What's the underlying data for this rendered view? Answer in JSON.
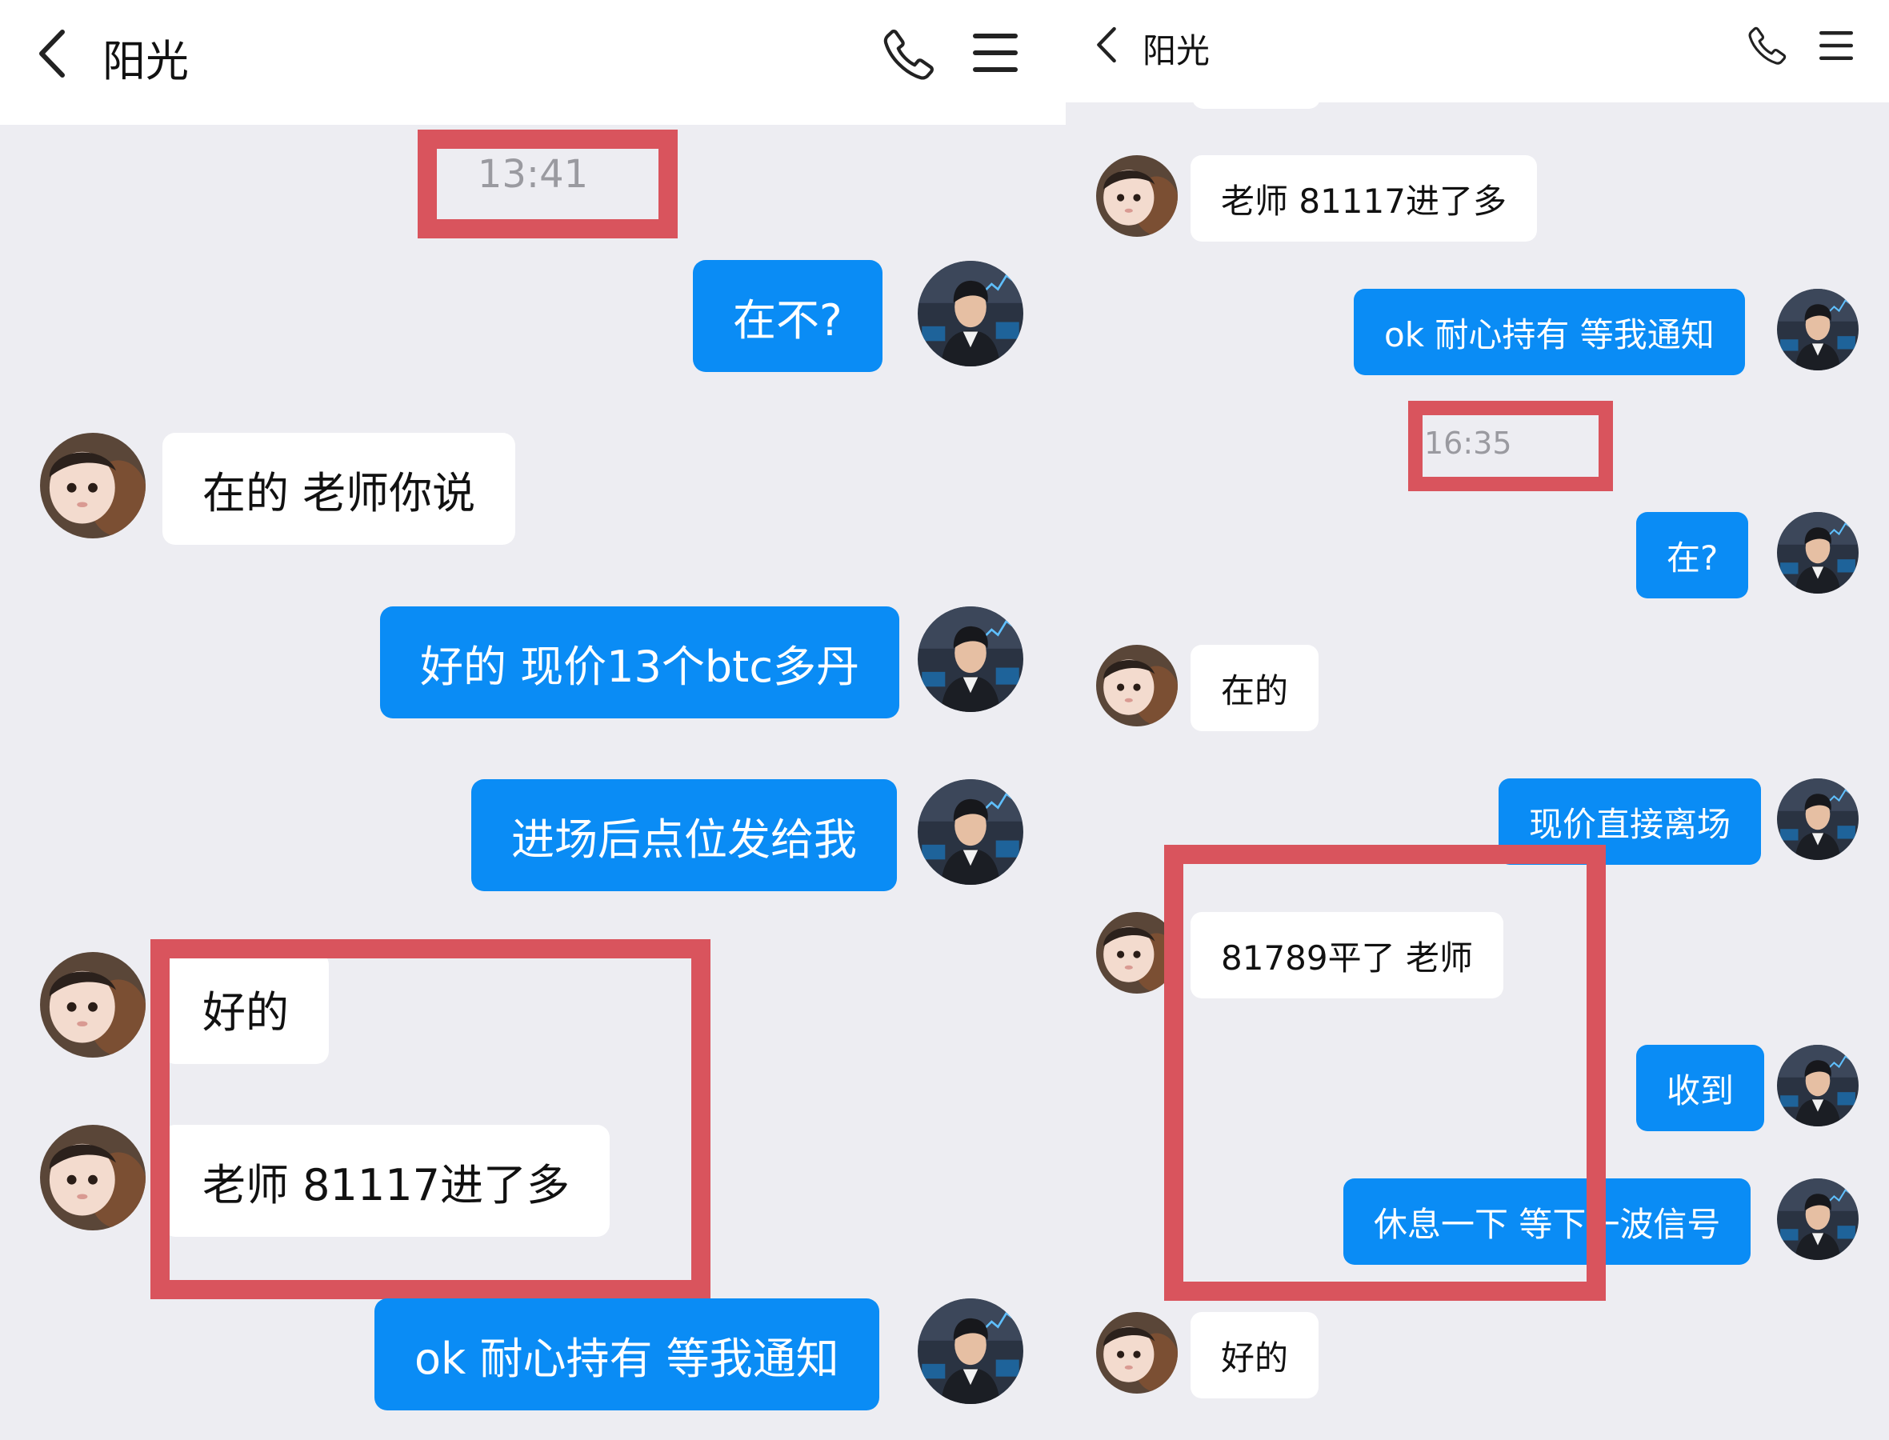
{
  "colors": {
    "outgoing_bubble": "#0a8cf5",
    "incoming_bubble": "#ffffff",
    "chat_background": "#ededf2",
    "highlight_box": "#d9545d",
    "timestamp_text": "#9a9aa0"
  },
  "icons": {
    "back": "chevron-left-icon",
    "call": "phone-icon",
    "menu": "hamburger-menu-icon"
  },
  "left_screen": {
    "header": {
      "title": "阳光"
    },
    "messages": [
      {
        "type": "time",
        "text": "13:41"
      },
      {
        "type": "out",
        "text": "在不?"
      },
      {
        "type": "in",
        "text": "在的  老师你说"
      },
      {
        "type": "out",
        "text": "好的  现价13个btc多丹"
      },
      {
        "type": "out",
        "text": "进场后点位发给我"
      },
      {
        "type": "in",
        "text": "好的"
      },
      {
        "type": "in",
        "text": "老师  81117进了多"
      },
      {
        "type": "out",
        "text": "ok  耐心持有  等我通知"
      }
    ]
  },
  "right_screen": {
    "header": {
      "title": "阳光"
    },
    "messages": [
      {
        "type": "in",
        "text": "老师  81117进了多"
      },
      {
        "type": "out",
        "text": "ok  耐心持有  等我通知"
      },
      {
        "type": "time",
        "text": "16:35"
      },
      {
        "type": "out",
        "text": "在?"
      },
      {
        "type": "in",
        "text": "在的"
      },
      {
        "type": "out",
        "text": "现价直接离场"
      },
      {
        "type": "in",
        "text": "81789平了  老师"
      },
      {
        "type": "out",
        "text": "收到"
      },
      {
        "type": "out",
        "text": "休息一下  等下一波信号"
      },
      {
        "type": "in",
        "text": "好的"
      }
    ]
  }
}
